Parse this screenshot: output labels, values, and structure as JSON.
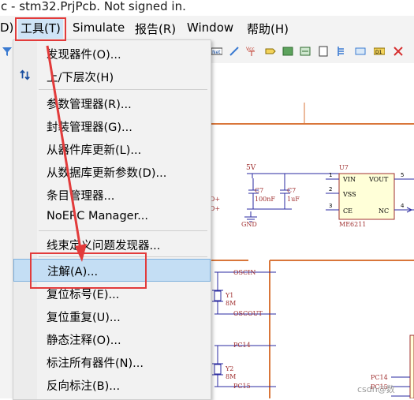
{
  "window": {
    "title": "c - stm32.PrjPcb. Not signed in."
  },
  "menubar": {
    "items": [
      {
        "label": "D)"
      },
      {
        "label": "工具(T)"
      },
      {
        "label": "Simulate"
      },
      {
        "label": "报告(R)"
      },
      {
        "label": "Window"
      },
      {
        "label": "帮助(H)"
      }
    ]
  },
  "dropdown": {
    "items": [
      {
        "label": "发现器件(O)..."
      },
      {
        "label": "上/下层次(H)"
      },
      {
        "label": "参数管理器(R)..."
      },
      {
        "label": "封装管理器(G)..."
      },
      {
        "label": "从器件库更新(L)..."
      },
      {
        "label": "从数据库更新参数(D)..."
      },
      {
        "label": "条目管理器..."
      },
      {
        "label": "NoERC Manager..."
      },
      {
        "label": "线束定义问题发现器..."
      },
      {
        "label": "注解(A)..."
      },
      {
        "label": "复位标号(E)..."
      },
      {
        "label": "复位重复(U)..."
      },
      {
        "label": "静态注释(O)..."
      },
      {
        "label": "标注所有器件(N)..."
      },
      {
        "label": "反向标注(B)..."
      }
    ]
  },
  "schematic": {
    "u7": "U7",
    "u7_part": "ME6211",
    "pins_left": [
      "VIN",
      "VSS",
      "CE"
    ],
    "pins_right": [
      "VOUT",
      "NC"
    ],
    "pin_nums": [
      "1",
      "2",
      "3",
      "5",
      "4"
    ],
    "c7": "C7",
    "c7_val": "100nF",
    "c7b": "C7",
    "c7b_val": "1uF",
    "net_5v": "5V",
    "gnd": "GND",
    "d_plus": "D+",
    "d_plus2": "D+",
    "y1": "Y1",
    "y1_val": "8M",
    "y2": "Y2",
    "y2_val": "8M",
    "oscin": "OSCIN",
    "oscout": "OSCOUT",
    "pc14": "PC14",
    "pc15": "PC15",
    "pc14b": "PC14",
    "pc15b": "PC15"
  },
  "watermark": "csdn@数"
}
